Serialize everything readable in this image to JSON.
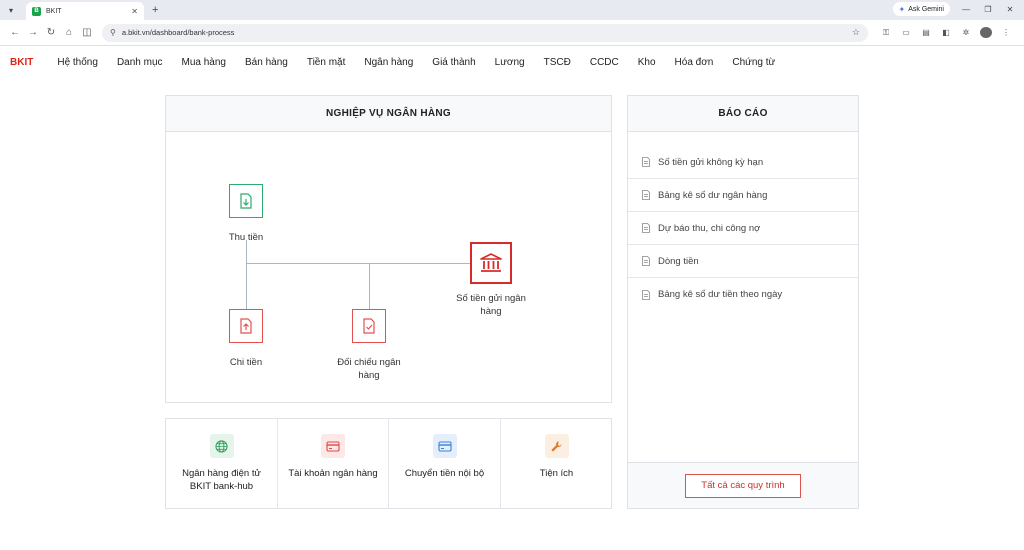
{
  "browser": {
    "tab_title": "BKIT",
    "tab_favicon": "B",
    "url": "a.bkit.vn/dashboard/bank-process",
    "gemini_label": "Ask Gemini"
  },
  "app": {
    "brand": "BKIT",
    "menu": [
      "Hệ thống",
      "Danh mục",
      "Mua hàng",
      "Bán hàng",
      "Tiền mặt",
      "Ngân hàng",
      "Giá thành",
      "Lương",
      "TSCĐ",
      "CCDC",
      "Kho",
      "Hóa đơn",
      "Chứng từ"
    ]
  },
  "process": {
    "title": "NGHIỆP VỤ NGÂN HÀNG",
    "nodes": {
      "thu_tien": "Thu tiền",
      "chi_tien": "Chi tiền",
      "doi_chieu": "Đối chiếu ngân hàng",
      "so_tien_gui": "Số tiền gửi ngân hàng"
    }
  },
  "tools": [
    {
      "label": "Ngân hàng điện tử BKIT bank-hub",
      "icon": "globe-icon",
      "color": "#2e9e5b",
      "bg": "#e6f5ec"
    },
    {
      "label": "Tài khoản ngân hàng",
      "icon": "card-icon",
      "color": "#e04848",
      "bg": "#fde8e8"
    },
    {
      "label": "Chuyển tiền nội bộ",
      "icon": "card-icon",
      "color": "#3b82d6",
      "bg": "#e5eefb"
    },
    {
      "label": "Tiện ích",
      "icon": "wrench-icon",
      "color": "#e07a2c",
      "bg": "#fdeee2"
    }
  ],
  "report": {
    "title": "BÁO CÁO",
    "items": [
      "Số tiền gửi không kỳ hạn",
      "Bảng kê số dư ngân hàng",
      "Dự báo thu, chi công nợ",
      "Dòng tiền",
      "Bảng kê số dư tiền theo ngày"
    ],
    "all_button": "Tất cả các quy trình"
  },
  "colors": {
    "brand": "#e0231b",
    "green_node": "#2eaa6e",
    "red_node": "#e35050",
    "connector": "#a9b6c6"
  }
}
